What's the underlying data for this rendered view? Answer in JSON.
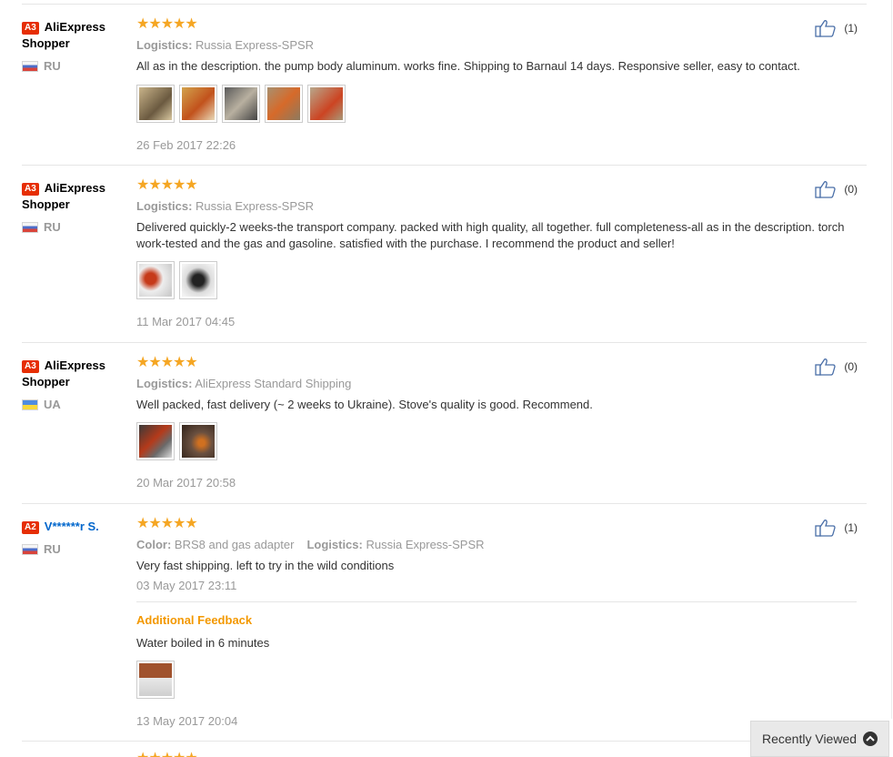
{
  "reviews": [
    {
      "level": "A3",
      "name": "AliExpress Shopper",
      "country": "RU",
      "stars": "★★★★★",
      "logistics_label": "Logistics:",
      "logistics": "Russia Express-SPSR",
      "text": "All as in the description. the pump body aluminum. works fine. Shipping to Barnaul 14 days. Responsive seller, easy to contact.",
      "date": "26 Feb 2017 22:26",
      "helpful": "(1)"
    },
    {
      "level": "A3",
      "name": "AliExpress Shopper",
      "country": "RU",
      "stars": "★★★★★",
      "logistics_label": "Logistics:",
      "logistics": "Russia Express-SPSR",
      "text": "Delivered quickly-2 weeks-the transport company. packed with high quality, all together. full completeness-all as in the description. torch work-tested and the gas and gasoline. satisfied with the purchase. I recommend the product and seller!",
      "date": "11 Mar 2017 04:45",
      "helpful": "(0)"
    },
    {
      "level": "A3",
      "name": "AliExpress Shopper",
      "country": "UA",
      "stars": "★★★★★",
      "logistics_label": "Logistics:",
      "logistics": "AliExpress Standard Shipping",
      "text": "Well packed, fast delivery (~ 2 weeks to Ukraine). Stove's quality is good. Recommend.",
      "date": "20 Mar 2017 20:58",
      "helpful": "(0)"
    },
    {
      "level": "A2",
      "name": "V******r S.",
      "country": "RU",
      "stars": "★★★★★",
      "color_label": "Color:",
      "color": "BRS8 and gas adapter",
      "logistics_label": "Logistics:",
      "logistics": "Russia Express-SPSR",
      "text": "Very fast shipping. left to try in the wild conditions",
      "date": "03 May 2017 23:11",
      "additional_title": "Additional Feedback",
      "additional_text": "Water boiled in 6 minutes",
      "additional_date": "13 May 2017 20:04",
      "helpful": "(1)"
    }
  ],
  "recently_viewed": "Recently Viewed",
  "colors": {
    "star": "#f5a623",
    "level_badge": "#e62e04",
    "additional": "#f39800",
    "link": "#0066cc"
  }
}
